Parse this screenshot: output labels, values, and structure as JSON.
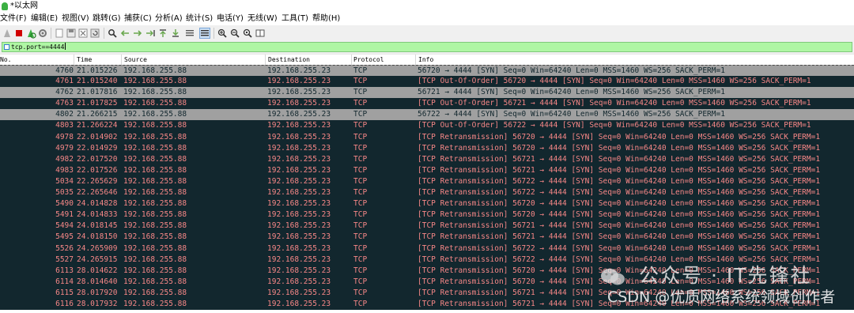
{
  "window": {
    "title": "*以太网"
  },
  "menu": [
    "文件(F)",
    "编辑(E)",
    "视图(V)",
    "跳转(G)",
    "捕获(C)",
    "分析(A)",
    "统计(S)",
    "电话(Y)",
    "无线(W)",
    "工具(T)",
    "帮助(H)"
  ],
  "toolbar": {
    "buttons": [
      "shark-fin-start-icon",
      "stop-square-icon",
      "restart-capture-icon",
      "capture-options-gear-icon",
      "open-file-icon",
      "save-file-icon",
      "close-file-icon",
      "reload-file-icon",
      "find-packet-icon",
      "go-back-arrow-icon",
      "go-forward-arrow-icon",
      "go-to-packet-icon",
      "go-first-packet-icon",
      "go-last-packet-icon",
      "auto-scroll-icon",
      "colorize-list-icon",
      "zoom-in-icon",
      "zoom-out-icon",
      "normal-size-icon",
      "resize-columns-icon"
    ]
  },
  "filter": {
    "value": "tcp.port==4444"
  },
  "columns": [
    "No.",
    "Time",
    "Source",
    "Destination",
    "Protocol",
    "Info"
  ],
  "colors": {
    "normal_bg": "#a0a0a0",
    "alert_bg": "#12272e",
    "alert_fg": "#f78787",
    "selected_bg": "#cce0f4",
    "filter_bg": "#aff6a4"
  },
  "packets": [
    {
      "no": "4760",
      "time": "21.015226",
      "source": "192.168.255.88",
      "destination": "192.168.255.23",
      "protocol": "TCP",
      "info": "56720 → 4444 [SYN] Seq=0 Win=64240 Len=0 MSS=1460 WS=256 SACK_PERM=1",
      "style": "normal"
    },
    {
      "no": "4761",
      "time": "21.015240",
      "source": "192.168.255.88",
      "destination": "192.168.255.23",
      "protocol": "TCP",
      "info": "[TCP Out-Of-Order] 56720 → 4444 [SYN] Seq=0 Win=64240 Len=0 MSS=1460 WS=256 SACK_PERM=1",
      "style": "alert"
    },
    {
      "no": "4762",
      "time": "21.017816",
      "source": "192.168.255.88",
      "destination": "192.168.255.23",
      "protocol": "TCP",
      "info": "56721 → 4444 [SYN] Seq=0 Win=64240 Len=0 MSS=1460 WS=256 SACK_PERM=1",
      "style": "normal"
    },
    {
      "no": "4763",
      "time": "21.017825",
      "source": "192.168.255.88",
      "destination": "192.168.255.23",
      "protocol": "TCP",
      "info": "[TCP Out-Of-Order] 56721 → 4444 [SYN] Seq=0 Win=64240 Len=0 MSS=1460 WS=256 SACK_PERM=1",
      "style": "alert"
    },
    {
      "no": "4802",
      "time": "21.266215",
      "source": "192.168.255.88",
      "destination": "192.168.255.23",
      "protocol": "TCP",
      "info": "56722 → 4444 [SYN] Seq=0 Win=64240 Len=0 MSS=1460 WS=256 SACK_PERM=1",
      "style": "normal"
    },
    {
      "no": "4803",
      "time": "21.266224",
      "source": "192.168.255.88",
      "destination": "192.168.255.23",
      "protocol": "TCP",
      "info": "[TCP Out-Of-Order] 56722 → 4444 [SYN] Seq=0 Win=64240 Len=0 MSS=1460 WS=256 SACK_PERM=1",
      "style": "alert"
    },
    {
      "no": "4978",
      "time": "22.014902",
      "source": "192.168.255.88",
      "destination": "192.168.255.23",
      "protocol": "TCP",
      "info": "[TCP Retransmission] 56720 → 4444 [SYN] Seq=0 Win=64240 Len=0 MSS=1460 WS=256 SACK_PERM=1",
      "style": "alert"
    },
    {
      "no": "4979",
      "time": "22.014929",
      "source": "192.168.255.88",
      "destination": "192.168.255.23",
      "protocol": "TCP",
      "info": "[TCP Retransmission] 56720 → 4444 [SYN] Seq=0 Win=64240 Len=0 MSS=1460 WS=256 SACK_PERM=1",
      "style": "alert"
    },
    {
      "no": "4982",
      "time": "22.017520",
      "source": "192.168.255.88",
      "destination": "192.168.255.23",
      "protocol": "TCP",
      "info": "[TCP Retransmission] 56721 → 4444 [SYN] Seq=0 Win=64240 Len=0 MSS=1460 WS=256 SACK_PERM=1",
      "style": "alert"
    },
    {
      "no": "4983",
      "time": "22.017526",
      "source": "192.168.255.88",
      "destination": "192.168.255.23",
      "protocol": "TCP",
      "info": "[TCP Retransmission] 56721 → 4444 [SYN] Seq=0 Win=64240 Len=0 MSS=1460 WS=256 SACK_PERM=1",
      "style": "alert"
    },
    {
      "no": "5034",
      "time": "22.265629",
      "source": "192.168.255.88",
      "destination": "192.168.255.23",
      "protocol": "TCP",
      "info": "[TCP Retransmission] 56722 → 4444 [SYN] Seq=0 Win=64240 Len=0 MSS=1460 WS=256 SACK_PERM=1",
      "style": "alert"
    },
    {
      "no": "5035",
      "time": "22.265646",
      "source": "192.168.255.88",
      "destination": "192.168.255.23",
      "protocol": "TCP",
      "info": "[TCP Retransmission] 56722 → 4444 [SYN] Seq=0 Win=64240 Len=0 MSS=1460 WS=256 SACK_PERM=1",
      "style": "alert"
    },
    {
      "no": "5490",
      "time": "24.014828",
      "source": "192.168.255.88",
      "destination": "192.168.255.23",
      "protocol": "TCP",
      "info": "[TCP Retransmission] 56720 → 4444 [SYN] Seq=0 Win=64240 Len=0 MSS=1460 WS=256 SACK_PERM=1",
      "style": "alert"
    },
    {
      "no": "5491",
      "time": "24.014833",
      "source": "192.168.255.88",
      "destination": "192.168.255.23",
      "protocol": "TCP",
      "info": "[TCP Retransmission] 56720 → 4444 [SYN] Seq=0 Win=64240 Len=0 MSS=1460 WS=256 SACK_PERM=1",
      "style": "alert"
    },
    {
      "no": "5494",
      "time": "24.018145",
      "source": "192.168.255.88",
      "destination": "192.168.255.23",
      "protocol": "TCP",
      "info": "[TCP Retransmission] 56721 → 4444 [SYN] Seq=0 Win=64240 Len=0 MSS=1460 WS=256 SACK_PERM=1",
      "style": "alert"
    },
    {
      "no": "5495",
      "time": "24.018150",
      "source": "192.168.255.88",
      "destination": "192.168.255.23",
      "protocol": "TCP",
      "info": "[TCP Retransmission] 56721 → 4444 [SYN] Seq=0 Win=64240 Len=0 MSS=1460 WS=256 SACK_PERM=1",
      "style": "alert"
    },
    {
      "no": "5526",
      "time": "24.265909",
      "source": "192.168.255.88",
      "destination": "192.168.255.23",
      "protocol": "TCP",
      "info": "[TCP Retransmission] 56722 → 4444 [SYN] Seq=0 Win=64240 Len=0 MSS=1460 WS=256 SACK_PERM=1",
      "style": "alert"
    },
    {
      "no": "5527",
      "time": "24.265915",
      "source": "192.168.255.88",
      "destination": "192.168.255.23",
      "protocol": "TCP",
      "info": "[TCP Retransmission] 56722 → 4444 [SYN] Seq=0 Win=64240 Len=0 MSS=1460 WS=256 SACK_PERM=1",
      "style": "alert"
    },
    {
      "no": "6113",
      "time": "28.014622",
      "source": "192.168.255.88",
      "destination": "192.168.255.23",
      "protocol": "TCP",
      "info": "[TCP Retransmission] 56720 → 4444 [SYN] Seq=0 Win=64240 Len=0 MSS=1460 WS=256 SACK_PERM=1",
      "style": "alert"
    },
    {
      "no": "6114",
      "time": "28.014640",
      "source": "192.168.255.88",
      "destination": "192.168.255.23",
      "protocol": "TCP",
      "info": "[TCP Retransmission] 56720 → 4444 [SYN] Seq=0 Win=64240 Len=0 MSS=1460 WS=256 SACK_PERM=1",
      "style": "alert"
    },
    {
      "no": "6115",
      "time": "28.017920",
      "source": "192.168.255.88",
      "destination": "192.168.255.23",
      "protocol": "TCP",
      "info": "[TCP Retransmission] 56721 → 4444 [SYN] Seq=0 Win=64240 Len=0 MSS=1460 WS=256 SACK_PERM=1",
      "style": "alert"
    },
    {
      "no": "6116",
      "time": "28.017932",
      "source": "192.168.255.88",
      "destination": "192.168.255.23",
      "protocol": "TCP",
      "info": "[TCP Retransmission] 56721 → 4444 [SYN] Seq=0 Win=64240 Len=0 MSS=1460 WS=256 SACK_PERM=1",
      "style": "alert"
    }
  ],
  "watermark": {
    "line1": "公众号 · IT先锋社",
    "line2": "CSDN @优质网络系统领域创作者"
  }
}
